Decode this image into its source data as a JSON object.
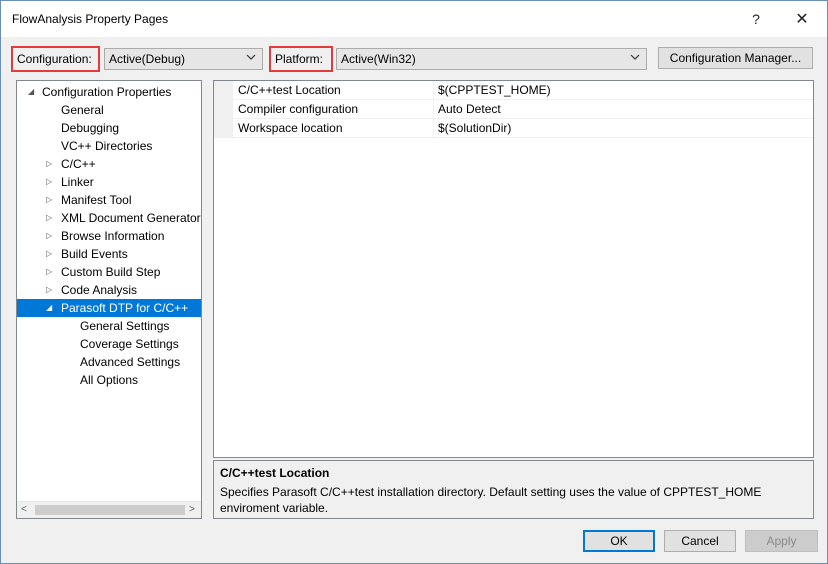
{
  "window": {
    "title": "FlowAnalysis Property Pages",
    "help_glyph": "?",
    "close_glyph": "✕"
  },
  "toolbar": {
    "configuration_label": "Configuration:",
    "configuration_value": "Active(Debug)",
    "platform_label": "Platform:",
    "platform_value": "Active(Win32)",
    "config_manager_label": "Configuration Manager..."
  },
  "tree": {
    "items": [
      {
        "label": "Configuration Properties",
        "expander": "◢"
      },
      {
        "label": "General",
        "expander": ""
      },
      {
        "label": "Debugging",
        "expander": ""
      },
      {
        "label": "VC++ Directories",
        "expander": ""
      },
      {
        "label": "C/C++",
        "expander": "▷"
      },
      {
        "label": "Linker",
        "expander": "▷"
      },
      {
        "label": "Manifest Tool",
        "expander": "▷"
      },
      {
        "label": "XML Document Generator",
        "expander": "▷"
      },
      {
        "label": "Browse Information",
        "expander": "▷"
      },
      {
        "label": "Build Events",
        "expander": "▷"
      },
      {
        "label": "Custom Build Step",
        "expander": "▷"
      },
      {
        "label": "Code Analysis",
        "expander": "▷"
      },
      {
        "label": "Parasoft DTP for C/C++",
        "expander": "◢"
      },
      {
        "label": "General Settings",
        "expander": ""
      },
      {
        "label": "Coverage Settings",
        "expander": ""
      },
      {
        "label": "Advanced Settings",
        "expander": ""
      },
      {
        "label": "All Options",
        "expander": ""
      }
    ],
    "selected_item": "Parasoft DTP for C/C++",
    "scroll_left_glyph": "<",
    "scroll_right_glyph": ">"
  },
  "properties": [
    {
      "name": "C/C++test Location",
      "value": "$(CPPTEST_HOME)"
    },
    {
      "name": "Compiler configuration",
      "value": "Auto Detect"
    },
    {
      "name": "Workspace location",
      "value": "$(SolutionDir)"
    }
  ],
  "description": {
    "title": "C/C++test Location",
    "text": "Specifies Parasoft C/C++test installation directory. Default setting uses the value of CPPTEST_HOME enviroment variable."
  },
  "buttons": {
    "ok": "OK",
    "cancel": "Cancel",
    "apply": "Apply"
  },
  "colors": {
    "selection": "#0078d7",
    "highlight_box": "#e23b3b"
  },
  "icons": {
    "dropdown": "chevron-down-icon",
    "expand": "triangle-right-icon",
    "collapse": "triangle-down-icon"
  }
}
